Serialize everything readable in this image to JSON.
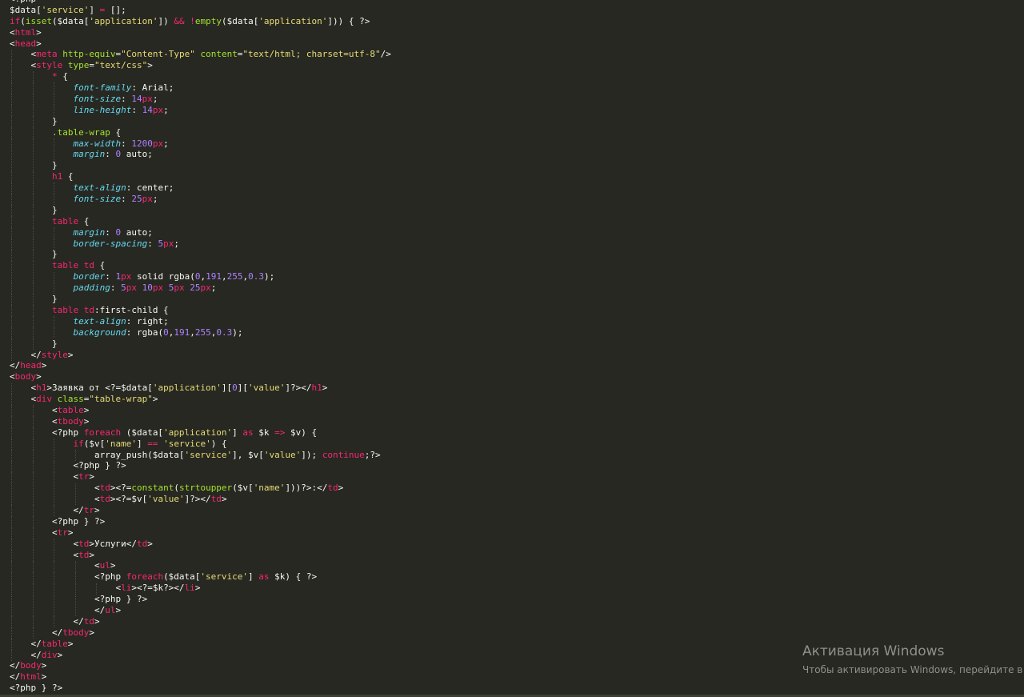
{
  "colors": {
    "background": "#272822",
    "plain": "#f8f8f2",
    "keyword": "#f92672",
    "string": "#e6db74",
    "attribute": "#a6e22e",
    "number": "#ae81ff",
    "property": "#66d9ef",
    "watermark": "#8f908a"
  },
  "code_lines": [
    [
      {
        "t": "x",
        "s": "<?php"
      }
    ],
    [
      {
        "t": "v",
        "s": "$data"
      },
      {
        "t": "p",
        "s": "["
      },
      {
        "t": "s",
        "s": "'service'"
      },
      {
        "t": "p",
        "s": "] "
      },
      {
        "t": "k",
        "s": "="
      },
      {
        "t": "p",
        "s": " [];"
      }
    ],
    [
      {
        "t": "k",
        "s": "if"
      },
      {
        "t": "p",
        "s": "("
      },
      {
        "t": "a",
        "s": "isset"
      },
      {
        "t": "p",
        "s": "($data["
      },
      {
        "t": "s",
        "s": "'application'"
      },
      {
        "t": "p",
        "s": "]) "
      },
      {
        "t": "k",
        "s": "&&"
      },
      {
        "t": "p",
        "s": " "
      },
      {
        "t": "k",
        "s": "!"
      },
      {
        "t": "a",
        "s": "empty"
      },
      {
        "t": "p",
        "s": "($data["
      },
      {
        "t": "s",
        "s": "'application'"
      },
      {
        "t": "p",
        "s": "])) { ?>"
      }
    ],
    [
      {
        "t": "p",
        "s": "<"
      },
      {
        "t": "k",
        "s": "html"
      },
      {
        "t": "p",
        "s": ">"
      }
    ],
    [
      {
        "t": "p",
        "s": "<"
      },
      {
        "t": "k",
        "s": "head"
      },
      {
        "t": "p",
        "s": ">"
      }
    ],
    [
      {
        "t": "p",
        "s": "    <"
      },
      {
        "t": "k",
        "s": "meta"
      },
      {
        "t": "p",
        "s": " "
      },
      {
        "t": "a",
        "s": "http-equiv"
      },
      {
        "t": "p",
        "s": "="
      },
      {
        "t": "s",
        "s": "\"Content-Type\""
      },
      {
        "t": "p",
        "s": " "
      },
      {
        "t": "a",
        "s": "content"
      },
      {
        "t": "p",
        "s": "="
      },
      {
        "t": "s",
        "s": "\"text/html; charset=utf-8\""
      },
      {
        "t": "p",
        "s": "/>"
      }
    ],
    [
      {
        "t": "p",
        "s": "    <"
      },
      {
        "t": "k",
        "s": "style"
      },
      {
        "t": "p",
        "s": " "
      },
      {
        "t": "a",
        "s": "type"
      },
      {
        "t": "p",
        "s": "="
      },
      {
        "t": "s",
        "s": "\"text/css\""
      },
      {
        "t": "p",
        "s": ">"
      }
    ],
    [
      {
        "t": "p",
        "s": "        "
      },
      {
        "t": "k",
        "s": "*"
      },
      {
        "t": "p",
        "s": " {"
      }
    ],
    [
      {
        "t": "p",
        "s": "            "
      },
      {
        "t": "pr",
        "s": "font-family"
      },
      {
        "t": "p",
        "s": ": Arial;"
      }
    ],
    [
      {
        "t": "p",
        "s": "            "
      },
      {
        "t": "pr",
        "s": "font-size"
      },
      {
        "t": "p",
        "s": ": "
      },
      {
        "t": "n",
        "s": "14"
      },
      {
        "t": "k",
        "s": "px"
      },
      {
        "t": "p",
        "s": ";"
      }
    ],
    [
      {
        "t": "p",
        "s": "            "
      },
      {
        "t": "pr",
        "s": "line-height"
      },
      {
        "t": "p",
        "s": ": "
      },
      {
        "t": "n",
        "s": "14"
      },
      {
        "t": "k",
        "s": "px"
      },
      {
        "t": "p",
        "s": ";"
      }
    ],
    [
      {
        "t": "p",
        "s": "        }"
      }
    ],
    [
      {
        "t": "p",
        "s": "        "
      },
      {
        "t": "a",
        "s": ".table-wrap"
      },
      {
        "t": "p",
        "s": " {"
      }
    ],
    [
      {
        "t": "p",
        "s": "            "
      },
      {
        "t": "pr",
        "s": "max-width"
      },
      {
        "t": "p",
        "s": ": "
      },
      {
        "t": "n",
        "s": "1200"
      },
      {
        "t": "k",
        "s": "px"
      },
      {
        "t": "p",
        "s": ";"
      }
    ],
    [
      {
        "t": "p",
        "s": "            "
      },
      {
        "t": "pr",
        "s": "margin"
      },
      {
        "t": "p",
        "s": ": "
      },
      {
        "t": "n",
        "s": "0"
      },
      {
        "t": "p",
        "s": " auto;"
      }
    ],
    [
      {
        "t": "p",
        "s": "        }"
      }
    ],
    [
      {
        "t": "p",
        "s": "        "
      },
      {
        "t": "k",
        "s": "h1"
      },
      {
        "t": "p",
        "s": " {"
      }
    ],
    [
      {
        "t": "p",
        "s": "            "
      },
      {
        "t": "pr",
        "s": "text-align"
      },
      {
        "t": "p",
        "s": ": center;"
      }
    ],
    [
      {
        "t": "p",
        "s": "            "
      },
      {
        "t": "pr",
        "s": "font-size"
      },
      {
        "t": "p",
        "s": ": "
      },
      {
        "t": "n",
        "s": "25"
      },
      {
        "t": "k",
        "s": "px"
      },
      {
        "t": "p",
        "s": ";"
      }
    ],
    [
      {
        "t": "p",
        "s": "        }"
      }
    ],
    [
      {
        "t": "p",
        "s": "        "
      },
      {
        "t": "k",
        "s": "table"
      },
      {
        "t": "p",
        "s": " {"
      }
    ],
    [
      {
        "t": "p",
        "s": "            "
      },
      {
        "t": "pr",
        "s": "margin"
      },
      {
        "t": "p",
        "s": ": "
      },
      {
        "t": "n",
        "s": "0"
      },
      {
        "t": "p",
        "s": " auto;"
      }
    ],
    [
      {
        "t": "p",
        "s": "            "
      },
      {
        "t": "pr",
        "s": "border-spacing"
      },
      {
        "t": "p",
        "s": ": "
      },
      {
        "t": "n",
        "s": "5"
      },
      {
        "t": "k",
        "s": "px"
      },
      {
        "t": "p",
        "s": ";"
      }
    ],
    [
      {
        "t": "p",
        "s": "        }"
      }
    ],
    [
      {
        "t": "p",
        "s": "        "
      },
      {
        "t": "k",
        "s": "table td"
      },
      {
        "t": "p",
        "s": " {"
      }
    ],
    [
      {
        "t": "p",
        "s": "            "
      },
      {
        "t": "pr",
        "s": "border"
      },
      {
        "t": "p",
        "s": ": "
      },
      {
        "t": "n",
        "s": "1"
      },
      {
        "t": "k",
        "s": "px"
      },
      {
        "t": "p",
        "s": " solid rgba("
      },
      {
        "t": "n",
        "s": "0"
      },
      {
        "t": "p",
        "s": ","
      },
      {
        "t": "n",
        "s": "191"
      },
      {
        "t": "p",
        "s": ","
      },
      {
        "t": "n",
        "s": "255"
      },
      {
        "t": "p",
        "s": ","
      },
      {
        "t": "n",
        "s": "0.3"
      },
      {
        "t": "p",
        "s": ");"
      }
    ],
    [
      {
        "t": "p",
        "s": "            "
      },
      {
        "t": "pr",
        "s": "padding"
      },
      {
        "t": "p",
        "s": ": "
      },
      {
        "t": "n",
        "s": "5"
      },
      {
        "t": "k",
        "s": "px"
      },
      {
        "t": "p",
        "s": " "
      },
      {
        "t": "n",
        "s": "10"
      },
      {
        "t": "k",
        "s": "px"
      },
      {
        "t": "p",
        "s": " "
      },
      {
        "t": "n",
        "s": "5"
      },
      {
        "t": "k",
        "s": "px"
      },
      {
        "t": "p",
        "s": " "
      },
      {
        "t": "n",
        "s": "25"
      },
      {
        "t": "k",
        "s": "px"
      },
      {
        "t": "p",
        "s": ";"
      }
    ],
    [
      {
        "t": "p",
        "s": "        }"
      }
    ],
    [
      {
        "t": "p",
        "s": "        "
      },
      {
        "t": "k",
        "s": "table td"
      },
      {
        "t": "p",
        "s": ":first-child {"
      }
    ],
    [
      {
        "t": "p",
        "s": "            "
      },
      {
        "t": "pr",
        "s": "text-align"
      },
      {
        "t": "p",
        "s": ": right;"
      }
    ],
    [
      {
        "t": "p",
        "s": "            "
      },
      {
        "t": "pr",
        "s": "background"
      },
      {
        "t": "p",
        "s": ": rgba("
      },
      {
        "t": "n",
        "s": "0"
      },
      {
        "t": "p",
        "s": ","
      },
      {
        "t": "n",
        "s": "191"
      },
      {
        "t": "p",
        "s": ","
      },
      {
        "t": "n",
        "s": "255"
      },
      {
        "t": "p",
        "s": ","
      },
      {
        "t": "n",
        "s": "0.3"
      },
      {
        "t": "p",
        "s": ");"
      }
    ],
    [
      {
        "t": "p",
        "s": "        }"
      }
    ],
    [
      {
        "t": "p",
        "s": "    </"
      },
      {
        "t": "k",
        "s": "style"
      },
      {
        "t": "p",
        "s": ">"
      }
    ],
    [
      {
        "t": "p",
        "s": "</"
      },
      {
        "t": "k",
        "s": "head"
      },
      {
        "t": "p",
        "s": ">"
      }
    ],
    [
      {
        "t": "p",
        "s": "<"
      },
      {
        "t": "k",
        "s": "body"
      },
      {
        "t": "p",
        "s": ">"
      }
    ],
    [
      {
        "t": "p",
        "s": "    <"
      },
      {
        "t": "k",
        "s": "h1"
      },
      {
        "t": "p",
        "s": ">Заявка от <?=$data["
      },
      {
        "t": "s",
        "s": "'application'"
      },
      {
        "t": "p",
        "s": "]["
      },
      {
        "t": "n",
        "s": "0"
      },
      {
        "t": "p",
        "s": "]["
      },
      {
        "t": "s",
        "s": "'value'"
      },
      {
        "t": "p",
        "s": "]?></"
      },
      {
        "t": "k",
        "s": "h1"
      },
      {
        "t": "p",
        "s": ">"
      }
    ],
    [
      {
        "t": "p",
        "s": "    <"
      },
      {
        "t": "k",
        "s": "div"
      },
      {
        "t": "p",
        "s": " "
      },
      {
        "t": "a",
        "s": "class"
      },
      {
        "t": "p",
        "s": "="
      },
      {
        "t": "s",
        "s": "\"table-wrap\""
      },
      {
        "t": "p",
        "s": ">"
      }
    ],
    [
      {
        "t": "p",
        "s": "        <"
      },
      {
        "t": "k",
        "s": "table"
      },
      {
        "t": "p",
        "s": ">"
      }
    ],
    [
      {
        "t": "p",
        "s": "        <"
      },
      {
        "t": "k",
        "s": "tbody"
      },
      {
        "t": "p",
        "s": ">"
      }
    ],
    [
      {
        "t": "p",
        "s": "        <?php "
      },
      {
        "t": "k",
        "s": "foreach"
      },
      {
        "t": "p",
        "s": " ($data["
      },
      {
        "t": "s",
        "s": "'application'"
      },
      {
        "t": "p",
        "s": "] "
      },
      {
        "t": "k",
        "s": "as"
      },
      {
        "t": "p",
        "s": " $k "
      },
      {
        "t": "k",
        "s": "=>"
      },
      {
        "t": "p",
        "s": " $v) {"
      }
    ],
    [
      {
        "t": "p",
        "s": "            "
      },
      {
        "t": "k",
        "s": "if"
      },
      {
        "t": "p",
        "s": "($v["
      },
      {
        "t": "s",
        "s": "'name'"
      },
      {
        "t": "p",
        "s": "] "
      },
      {
        "t": "k",
        "s": "=="
      },
      {
        "t": "p",
        "s": " "
      },
      {
        "t": "s",
        "s": "'service'"
      },
      {
        "t": "p",
        "s": ") {"
      }
    ],
    [
      {
        "t": "p",
        "s": "                array_push($data["
      },
      {
        "t": "s",
        "s": "'service'"
      },
      {
        "t": "p",
        "s": "], $v["
      },
      {
        "t": "s",
        "s": "'value'"
      },
      {
        "t": "p",
        "s": "]); "
      },
      {
        "t": "k",
        "s": "continue"
      },
      {
        "t": "p",
        "s": ";?>"
      }
    ],
    [
      {
        "t": "p",
        "s": "            <?php } ?>"
      }
    ],
    [
      {
        "t": "p",
        "s": "            <"
      },
      {
        "t": "k",
        "s": "tr"
      },
      {
        "t": "p",
        "s": ">"
      }
    ],
    [
      {
        "t": "p",
        "s": "                <"
      },
      {
        "t": "k",
        "s": "td"
      },
      {
        "t": "p",
        "s": "><?="
      },
      {
        "t": "a",
        "s": "constant"
      },
      {
        "t": "p",
        "s": "("
      },
      {
        "t": "a",
        "s": "strtoupper"
      },
      {
        "t": "p",
        "s": "($v["
      },
      {
        "t": "s",
        "s": "'name'"
      },
      {
        "t": "p",
        "s": "]))?>:</"
      },
      {
        "t": "k",
        "s": "td"
      },
      {
        "t": "p",
        "s": ">"
      }
    ],
    [
      {
        "t": "p",
        "s": "                <"
      },
      {
        "t": "k",
        "s": "td"
      },
      {
        "t": "p",
        "s": "><?=$v["
      },
      {
        "t": "s",
        "s": "'value'"
      },
      {
        "t": "p",
        "s": "]?></"
      },
      {
        "t": "k",
        "s": "td"
      },
      {
        "t": "p",
        "s": ">"
      }
    ],
    [
      {
        "t": "p",
        "s": "            </"
      },
      {
        "t": "k",
        "s": "tr"
      },
      {
        "t": "p",
        "s": ">"
      }
    ],
    [
      {
        "t": "p",
        "s": "        <?php } ?>"
      }
    ],
    [
      {
        "t": "p",
        "s": "        <"
      },
      {
        "t": "k",
        "s": "tr"
      },
      {
        "t": "p",
        "s": ">"
      }
    ],
    [
      {
        "t": "p",
        "s": "            <"
      },
      {
        "t": "k",
        "s": "td"
      },
      {
        "t": "p",
        "s": ">Услуги</"
      },
      {
        "t": "k",
        "s": "td"
      },
      {
        "t": "p",
        "s": ">"
      }
    ],
    [
      {
        "t": "p",
        "s": "            <"
      },
      {
        "t": "k",
        "s": "td"
      },
      {
        "t": "p",
        "s": ">"
      }
    ],
    [
      {
        "t": "p",
        "s": "                <"
      },
      {
        "t": "k",
        "s": "ul"
      },
      {
        "t": "p",
        "s": ">"
      }
    ],
    [
      {
        "t": "p",
        "s": "                <?php "
      },
      {
        "t": "k",
        "s": "foreach"
      },
      {
        "t": "p",
        "s": "($data["
      },
      {
        "t": "s",
        "s": "'service'"
      },
      {
        "t": "p",
        "s": "] "
      },
      {
        "t": "k",
        "s": "as"
      },
      {
        "t": "p",
        "s": " $k) { ?>"
      }
    ],
    [
      {
        "t": "p",
        "s": "                    <"
      },
      {
        "t": "k",
        "s": "li"
      },
      {
        "t": "p",
        "s": "><?=$k?></"
      },
      {
        "t": "k",
        "s": "li"
      },
      {
        "t": "p",
        "s": ">"
      }
    ],
    [
      {
        "t": "p",
        "s": "                <?php } ?>"
      }
    ],
    [
      {
        "t": "p",
        "s": "                </"
      },
      {
        "t": "k",
        "s": "ul"
      },
      {
        "t": "p",
        "s": ">"
      }
    ],
    [
      {
        "t": "p",
        "s": "            </"
      },
      {
        "t": "k",
        "s": "td"
      },
      {
        "t": "p",
        "s": ">"
      }
    ],
    [
      {
        "t": "p",
        "s": "        </"
      },
      {
        "t": "k",
        "s": "tbody"
      },
      {
        "t": "p",
        "s": ">"
      }
    ],
    [
      {
        "t": "p",
        "s": "    </"
      },
      {
        "t": "k",
        "s": "table"
      },
      {
        "t": "p",
        "s": ">"
      }
    ],
    [
      {
        "t": "p",
        "s": "    </"
      },
      {
        "t": "k",
        "s": "div"
      },
      {
        "t": "p",
        "s": ">"
      }
    ],
    [
      {
        "t": "p",
        "s": "</"
      },
      {
        "t": "k",
        "s": "body"
      },
      {
        "t": "p",
        "s": ">"
      }
    ],
    [
      {
        "t": "p",
        "s": "</"
      },
      {
        "t": "k",
        "s": "html"
      },
      {
        "t": "p",
        "s": ">"
      }
    ],
    [
      {
        "t": "p",
        "s": "<?php } ?>"
      }
    ]
  ],
  "watermark": {
    "title": "Активация Windows",
    "subtitle": "Чтобы активировать Windows, перейдите в"
  }
}
